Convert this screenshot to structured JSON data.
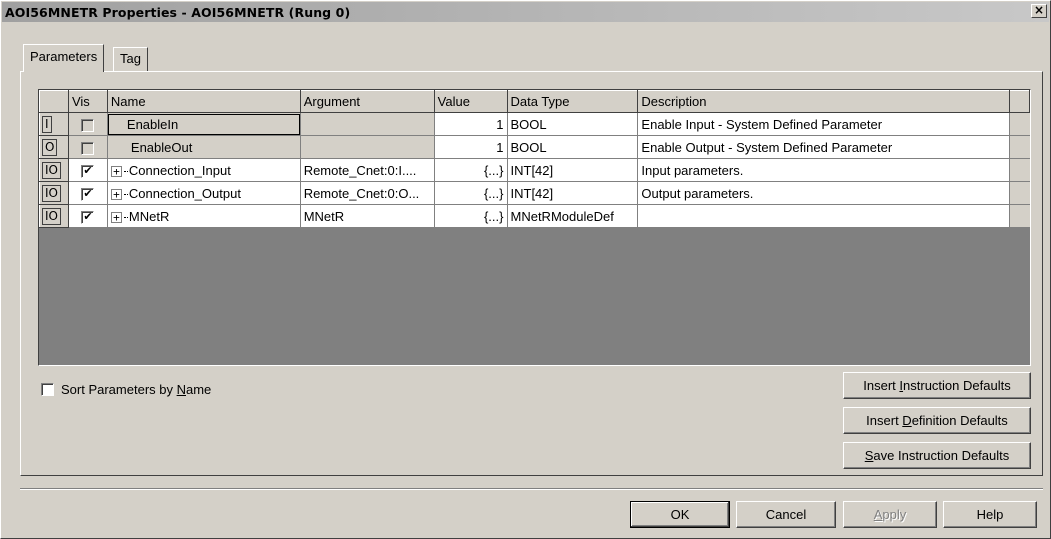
{
  "window": {
    "title": "AOI56MNETR Properties - AOI56MNETR (Rung 0)",
    "close_glyph": "×"
  },
  "tabs": [
    {
      "label": "Parameters",
      "active": true
    },
    {
      "label": "Tag",
      "active": false
    }
  ],
  "grid": {
    "columns": [
      "",
      "Vis",
      "Name",
      "Argument",
      "Value",
      "Data Type",
      "Description"
    ],
    "rows": [
      {
        "usage": "I",
        "vis": false,
        "vis_enabled": false,
        "expandable": false,
        "name": "EnableIn",
        "argument": "",
        "value": "1",
        "data_type": "BOOL",
        "description": "Enable Input - System Defined Parameter"
      },
      {
        "usage": "O",
        "vis": false,
        "vis_enabled": false,
        "expandable": false,
        "name": "EnableOut",
        "argument": "",
        "value": "1",
        "data_type": "BOOL",
        "description": "Enable Output - System Defined Parameter"
      },
      {
        "usage": "IO",
        "vis": true,
        "vis_enabled": true,
        "expandable": true,
        "name": "Connection_Input",
        "argument": "Remote_Cnet:0:I....",
        "value": "{...}",
        "data_type": "INT[42]",
        "description": "Input parameters."
      },
      {
        "usage": "IO",
        "vis": true,
        "vis_enabled": true,
        "expandable": true,
        "name": "Connection_Output",
        "argument": "Remote_Cnet:0:O...",
        "value": "{...}",
        "data_type": "INT[42]",
        "description": "Output parameters."
      },
      {
        "usage": "IO",
        "vis": true,
        "vis_enabled": true,
        "expandable": true,
        "name": "MNetR",
        "argument": "MNetR",
        "value": "{...}",
        "data_type": "MNetRModuleDef",
        "description": ""
      }
    ],
    "expand_glyph": "+",
    "check_glyph": "✔"
  },
  "sort_option": {
    "label_pre": "Sort Parameters by ",
    "label_ul": "N",
    "label_post": "ame",
    "checked": false
  },
  "side_buttons": {
    "insert_instruction": {
      "pre": "Insert ",
      "ul": "I",
      "post": "nstruction Defaults"
    },
    "insert_definition": {
      "pre": "Insert ",
      "ul": "D",
      "post": "efinition Defaults"
    },
    "save_instruction": {
      "pre": "",
      "ul": "S",
      "post": "ave Instruction Defaults"
    }
  },
  "footer_buttons": {
    "ok": "OK",
    "cancel": "Cancel",
    "apply_ul": "A",
    "apply_post": "pply",
    "help": "Help"
  }
}
